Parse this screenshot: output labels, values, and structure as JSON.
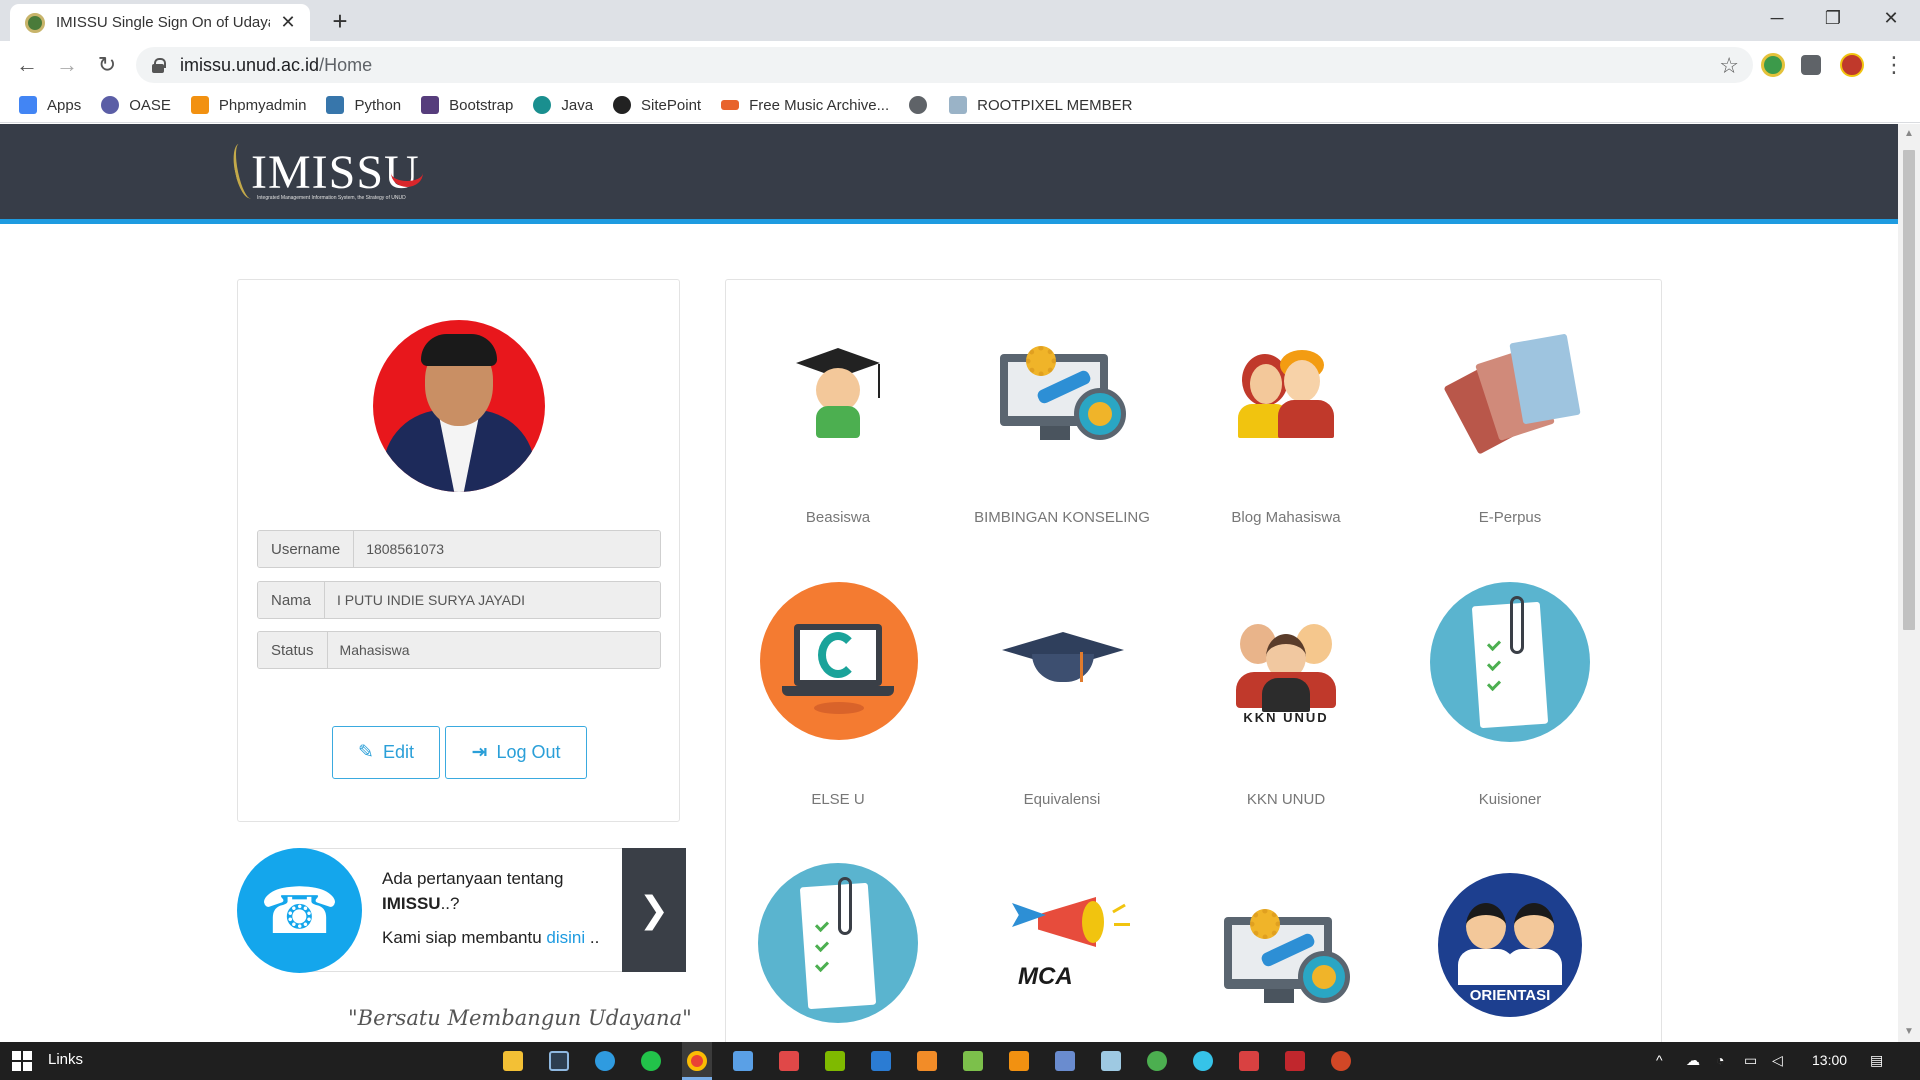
{
  "browser": {
    "tab_title": "IMISSU Single Sign On of Udayana",
    "tab_close": "✕",
    "new_tab": "+",
    "url_host": "imissu.unud.ac.id",
    "url_path": "/Home",
    "window_controls": {
      "minimize": "─",
      "restore": "❐",
      "close": "✕"
    }
  },
  "bookmarks": [
    {
      "label": "Apps",
      "color": "#4285f4"
    },
    {
      "label": "OASE",
      "color": "#5b5ea6"
    },
    {
      "label": "Phpmyadmin",
      "color": "#f29111"
    },
    {
      "label": "Python",
      "color": "#3776ab"
    },
    {
      "label": "Bootstrap",
      "color": "#563d7c"
    },
    {
      "label": "Java",
      "color": "#1a8f8f"
    },
    {
      "label": "SitePoint",
      "color": "#222222"
    },
    {
      "label": "Free Music Archive...",
      "color": "#e8632c"
    },
    {
      "label": "",
      "color": "#5f6368"
    },
    {
      "label": "ROOTPIXEL MEMBER",
      "color": "#9ab3c7"
    }
  ],
  "header": {
    "logo_text": "IMISSU",
    "logo_tagline": "Integrated Management Information System, the Strategy of UNUD"
  },
  "profile": {
    "fields": [
      {
        "label": "Username",
        "value": "1808561073"
      },
      {
        "label": "Nama",
        "value": "I PUTU INDIE SURYA JAYADI"
      },
      {
        "label": "Status",
        "value": "Mahasiswa"
      }
    ],
    "edit_label": "Edit",
    "logout_label": "Log Out"
  },
  "help": {
    "line1_prefix": "Ada pertanyaan tentang ",
    "line1_bold": "IMISSU",
    "line1_suffix": "..?",
    "line2_prefix": "Kami siap membantu ",
    "line2_link": "disini",
    "line2_suffix": " .."
  },
  "motto": "\"Bersatu Membangun Udayana\"",
  "apps": [
    {
      "label": "Beasiswa",
      "icon": "graduate-icon"
    },
    {
      "label": "BIMBINGAN KONSELING",
      "icon": "monitor-gear-icon"
    },
    {
      "label": "Blog Mahasiswa",
      "icon": "people-icon"
    },
    {
      "label": "E-Perpus",
      "icon": "books-icon"
    },
    {
      "label": "ELSE U",
      "icon": "elearning-icon"
    },
    {
      "label": "Equivalensi",
      "icon": "mortarboard-icon"
    },
    {
      "label": "KKN UNUD",
      "icon": "kkn-group-icon"
    },
    {
      "label": "Kuisioner",
      "icon": "clipboard-icon"
    },
    {
      "label": "",
      "icon": "clipboard-icon"
    },
    {
      "label": "",
      "icon": "megaphone-icon"
    },
    {
      "label": "",
      "icon": "monitor-gear-icon"
    },
    {
      "label": "",
      "icon": "orientasi-icon"
    }
  ],
  "icon_text": {
    "kkn": "KKN UNUD",
    "mca": "MCA",
    "orientasi": "ORIENTASI"
  },
  "taskbar": {
    "links_label": "Links",
    "clock": "13:00"
  },
  "colors": {
    "header_bg": "#373d48",
    "accent_blue": "#1e9be0",
    "button_text": "#2a9fd8",
    "avatar_bg": "#e8171c"
  }
}
